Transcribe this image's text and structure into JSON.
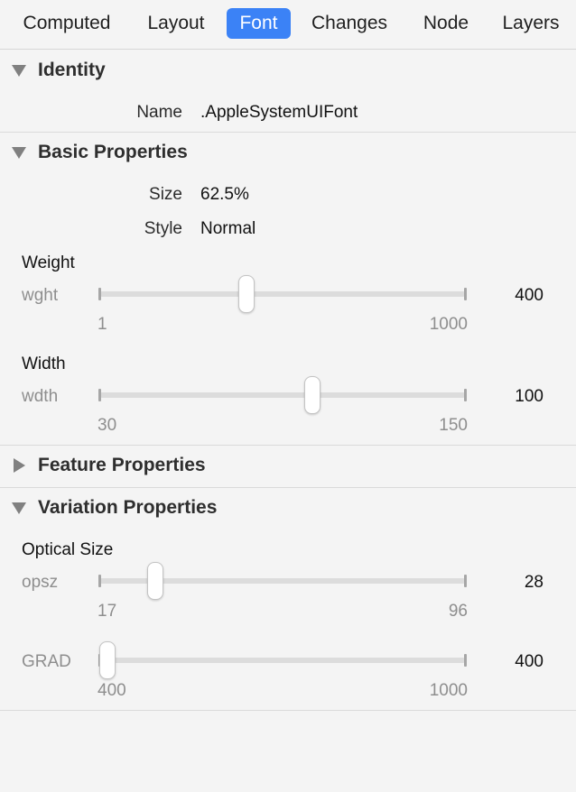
{
  "tabs": [
    {
      "label": "Computed",
      "active": false
    },
    {
      "label": "Layout",
      "active": false
    },
    {
      "label": "Font",
      "active": true
    },
    {
      "label": "Changes",
      "active": false
    },
    {
      "label": "Node",
      "active": false
    },
    {
      "label": "Layers",
      "active": false
    }
  ],
  "accent_color": "#3b82f6",
  "sections": {
    "identity": {
      "title": "Identity",
      "expanded": true
    },
    "basic": {
      "title": "Basic Properties",
      "expanded": true
    },
    "feature": {
      "title": "Feature Properties",
      "expanded": false
    },
    "variation": {
      "title": "Variation Properties",
      "expanded": true
    }
  },
  "identity": {
    "name_label": "Name",
    "name_value": ".AppleSystemUIFont"
  },
  "basic": {
    "size_label": "Size",
    "size_value": "62.5%",
    "style_label": "Style",
    "style_value": "Normal",
    "sliders": [
      {
        "title": "Weight",
        "tag": "wght",
        "min": "1",
        "max": "1000",
        "value": "400",
        "position": 0.4
      },
      {
        "title": "Width",
        "tag": "wdth",
        "min": "30",
        "max": "150",
        "value": "100",
        "position": 0.58
      }
    ]
  },
  "variation": {
    "sliders": [
      {
        "title": "Optical Size",
        "tag": "opsz",
        "min": "17",
        "max": "96",
        "value": "28",
        "position": 0.15
      },
      {
        "title": "",
        "tag": "GRAD",
        "min": "400",
        "max": "1000",
        "value": "400",
        "position": 0.0
      }
    ]
  }
}
